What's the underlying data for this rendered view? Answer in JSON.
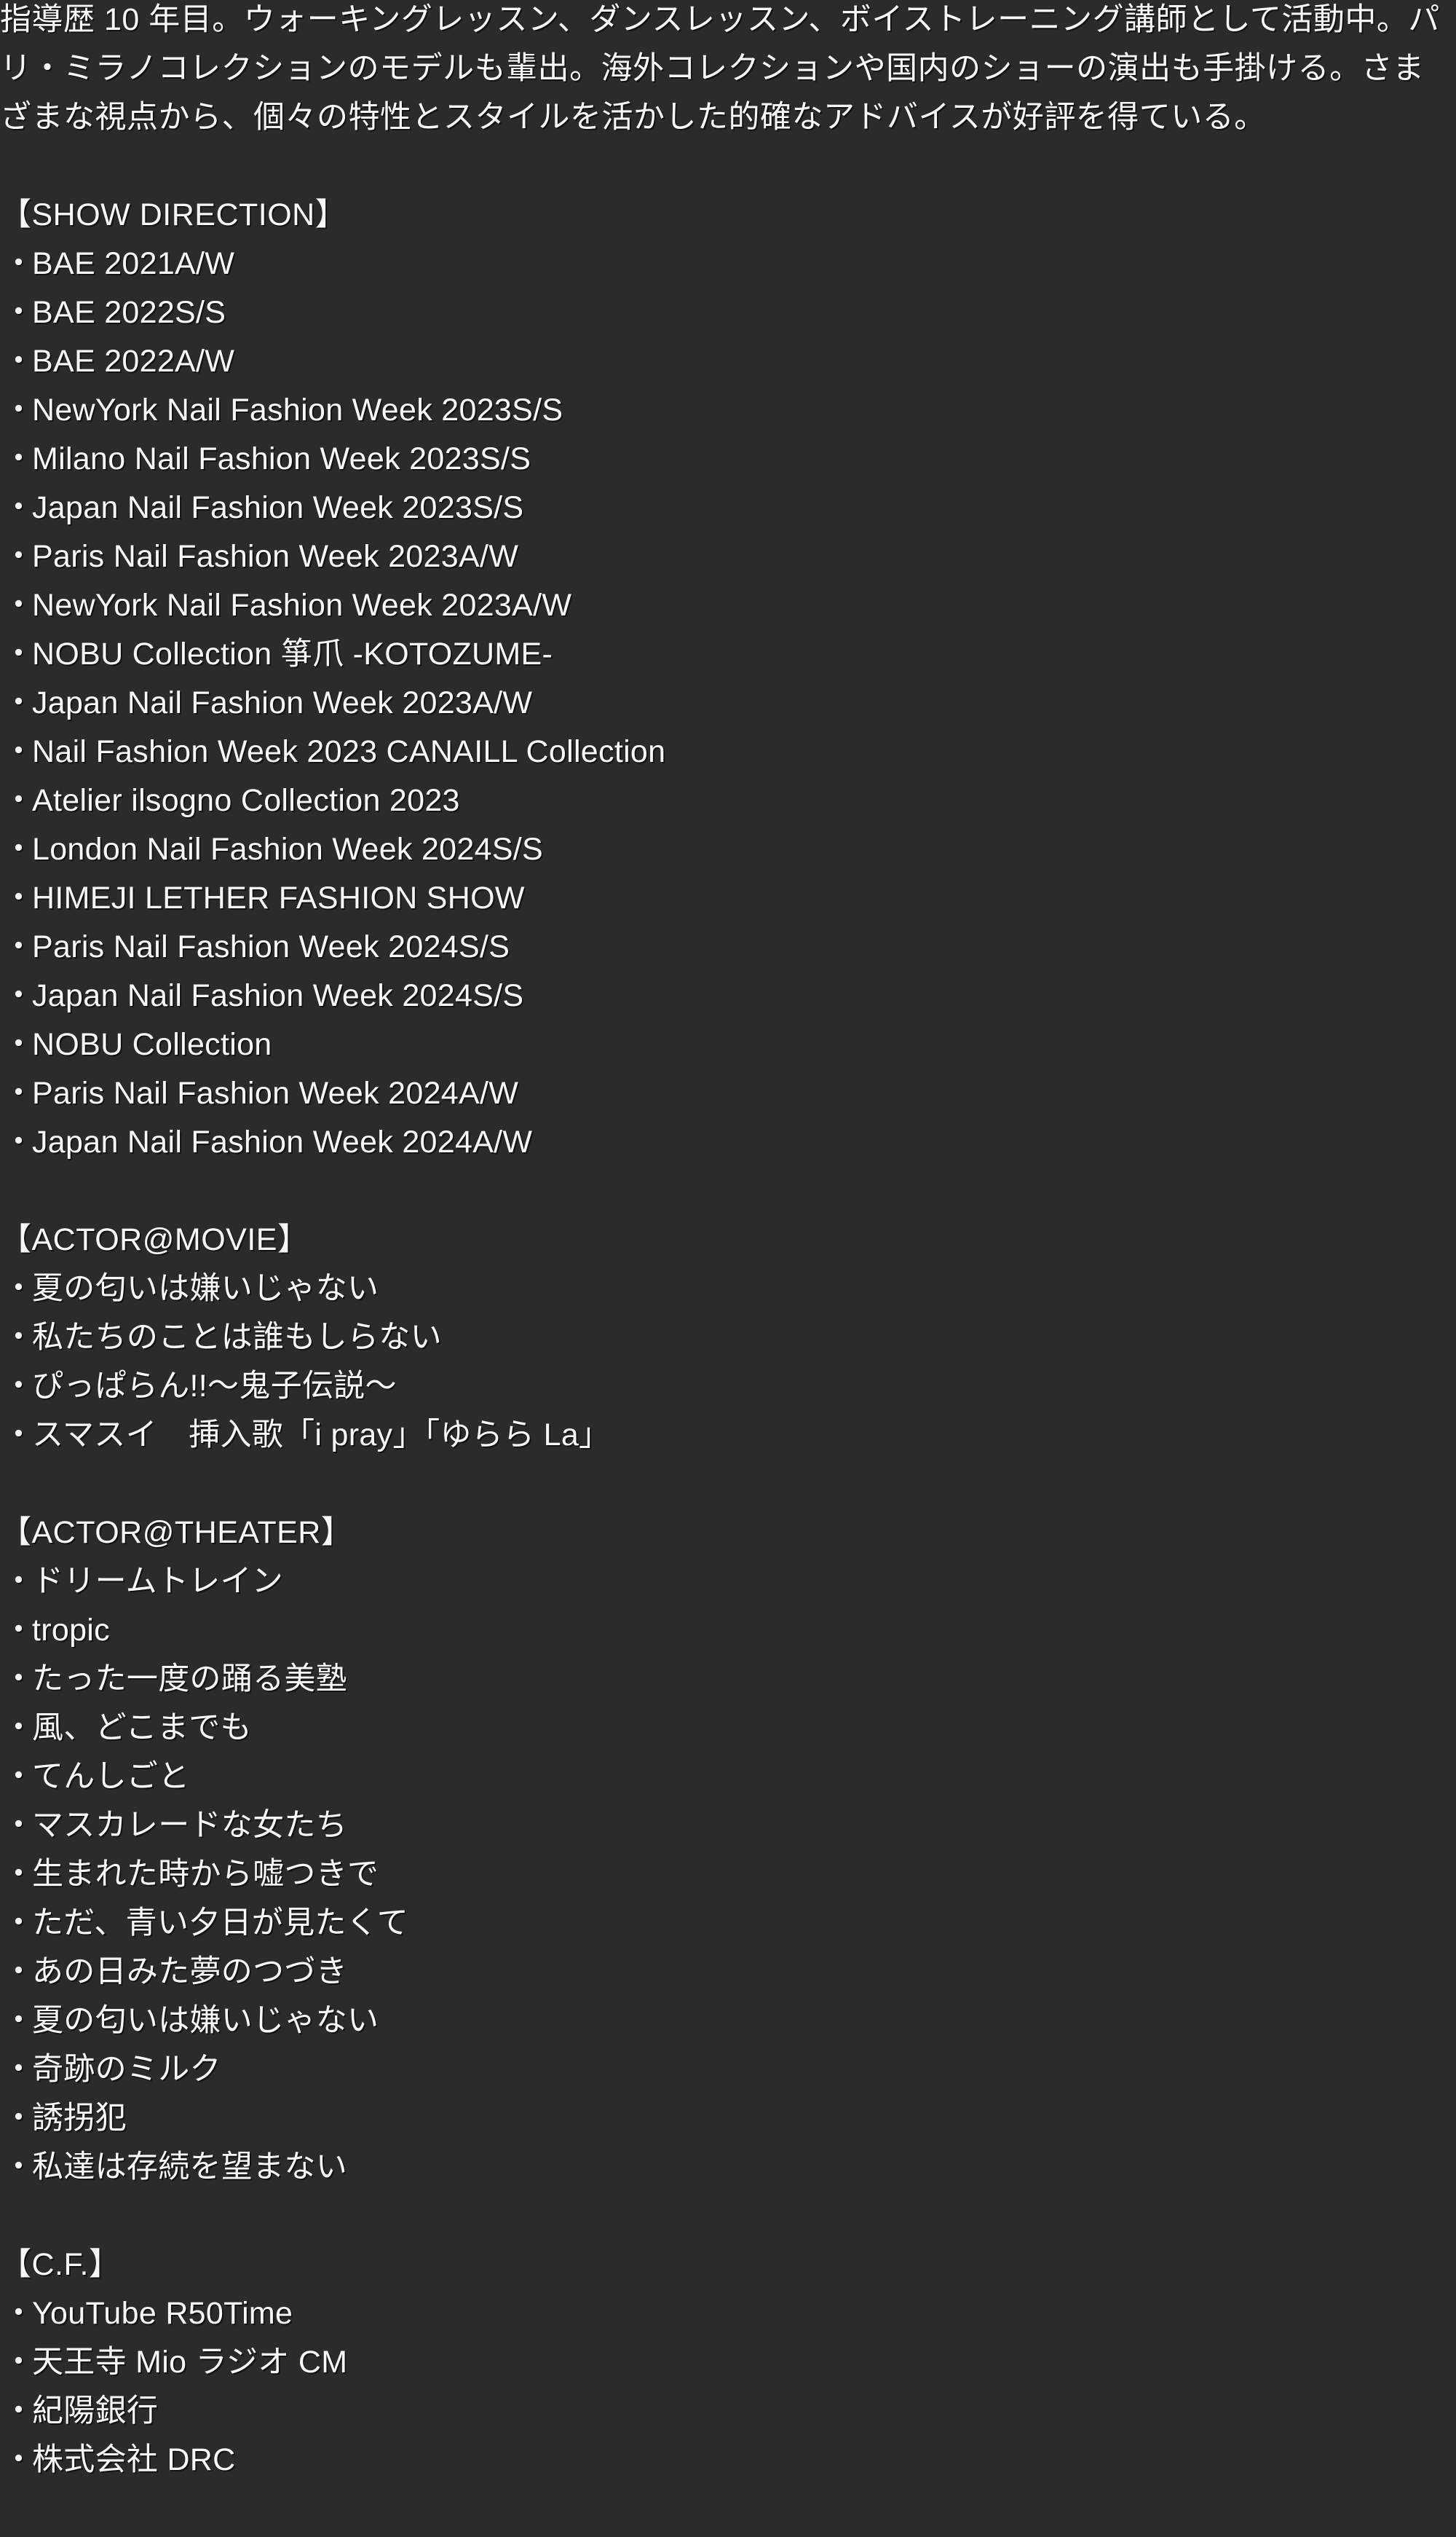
{
  "page": {
    "background_color": "#2b2b2b",
    "text_color": "#f7f7f7"
  },
  "intro": {
    "paragraph": "指導歴 10 年目。ウォーキングレッスン、ダンスレッスン、ボイストレーニング講師として活動中。パリ・ミラノコレクションのモデルも輩出。海外コレクションや国内のショーの演出も手掛ける。さまざまな視点から、個々の特性とスタイルを活かした的確なアドバイスが好評を得ている。"
  },
  "bullet_glyph": "・",
  "sections": [
    {
      "header": "【SHOW DIRECTION】",
      "items": [
        "BAE 2021A/W",
        "BAE 2022S/S",
        "BAE 2022A/W",
        "NewYork Nail Fashion Week 2023S/S",
        "Milano Nail Fashion Week 2023S/S",
        "Japan Nail Fashion Week 2023S/S",
        "Paris Nail Fashion Week 2023A/W",
        "NewYork Nail Fashion Week 2023A/W",
        "NOBU Collection 箏爪 -KOTOZUME-",
        "Japan Nail Fashion Week 2023A/W",
        "Nail Fashion Week 2023 CANAILL Collection",
        "Atelier ilsogno Collection 2023",
        "London Nail Fashion Week 2024S/S",
        "HIMEJI LETHER FASHION SHOW",
        "Paris Nail Fashion Week 2024S/S",
        "Japan Nail Fashion Week 2024S/S",
        "NOBU Collection",
        "Paris Nail Fashion Week 2024A/W",
        "Japan Nail Fashion Week 2024A/W"
      ]
    },
    {
      "header": "【ACTOR@MOVIE】",
      "items": [
        "夏の匂いは嫌いじゃない",
        "私たちのことは誰もしらない",
        "ぴっぱらん!!〜鬼子伝説〜",
        "スマスイ　挿入歌「i pray」「ゆらら La」"
      ]
    },
    {
      "header": "【ACTOR@THEATER】",
      "items": [
        "ドリームトレイン",
        "tropic",
        "たった一度の踊る美塾",
        "風、どこまでも",
        "てんしごと",
        "マスカレードな女たち",
        "生まれた時から嘘つきで",
        "ただ、青い夕日が見たくて",
        "あの日みた夢のつづき",
        "夏の匂いは嫌いじゃない",
        "奇跡のミルク",
        "誘拐犯",
        "私達は存続を望まない"
      ]
    },
    {
      "header": "【C.F.】",
      "items": [
        "YouTube R50Time",
        "天王寺 Mio ラジオ CM",
        "紀陽銀行",
        "株式会社 DRC"
      ]
    }
  ]
}
